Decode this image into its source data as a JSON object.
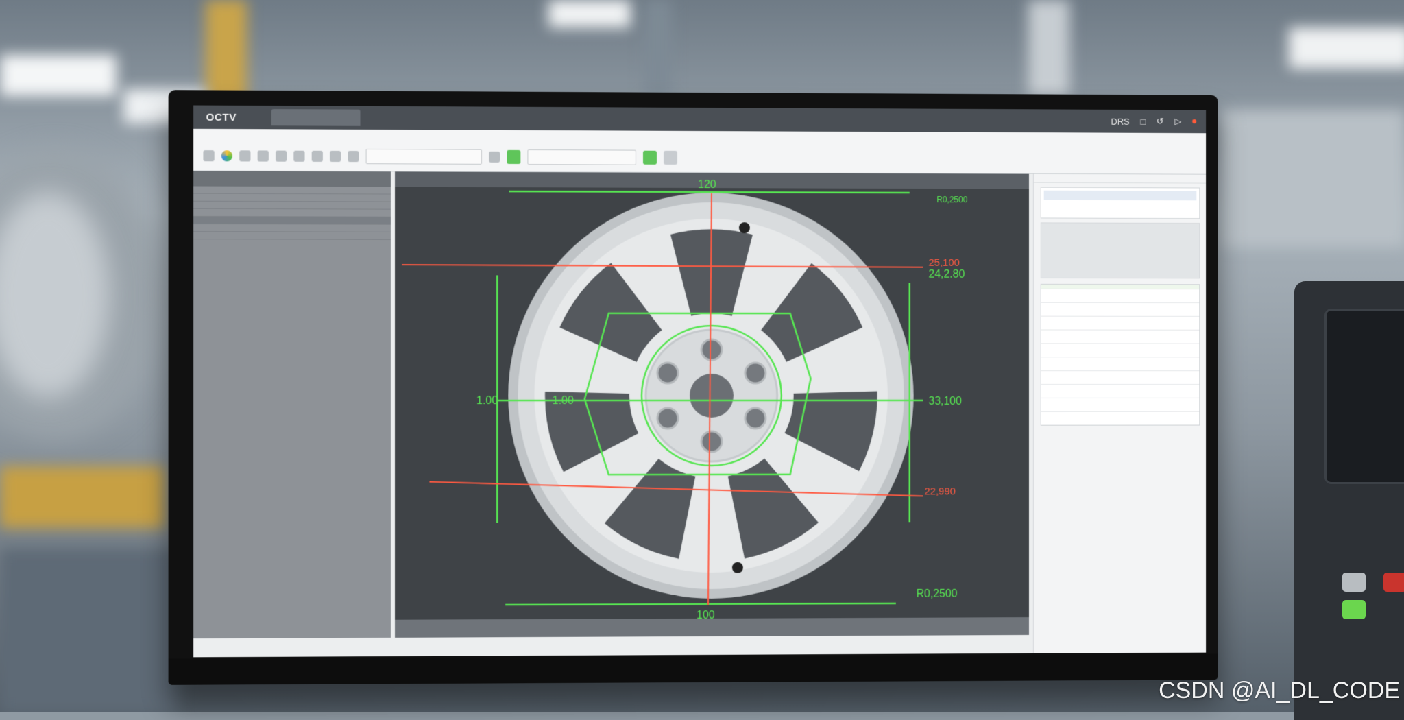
{
  "window": {
    "app_title": "OCTV",
    "controls": [
      "DRS",
      "□",
      "↺",
      "▷",
      "⏺"
    ]
  },
  "viewport": {
    "dimensions": {
      "top": "120",
      "bottom": "100",
      "left_outer": "1.00",
      "left_inner": "1.00",
      "right_mid": "33,100",
      "right_top_red": "25,100",
      "right_top_green": "24,2.80",
      "right_lower_red": "22,990",
      "bottom_right": "R0,2500",
      "top_right_label": "R0,2500"
    }
  },
  "colors": {
    "accent_green": "#57e552",
    "accent_red": "#ff5a42",
    "panel_dark": "#3f4347"
  },
  "watermark": "CSDN @AI_DL_CODE"
}
